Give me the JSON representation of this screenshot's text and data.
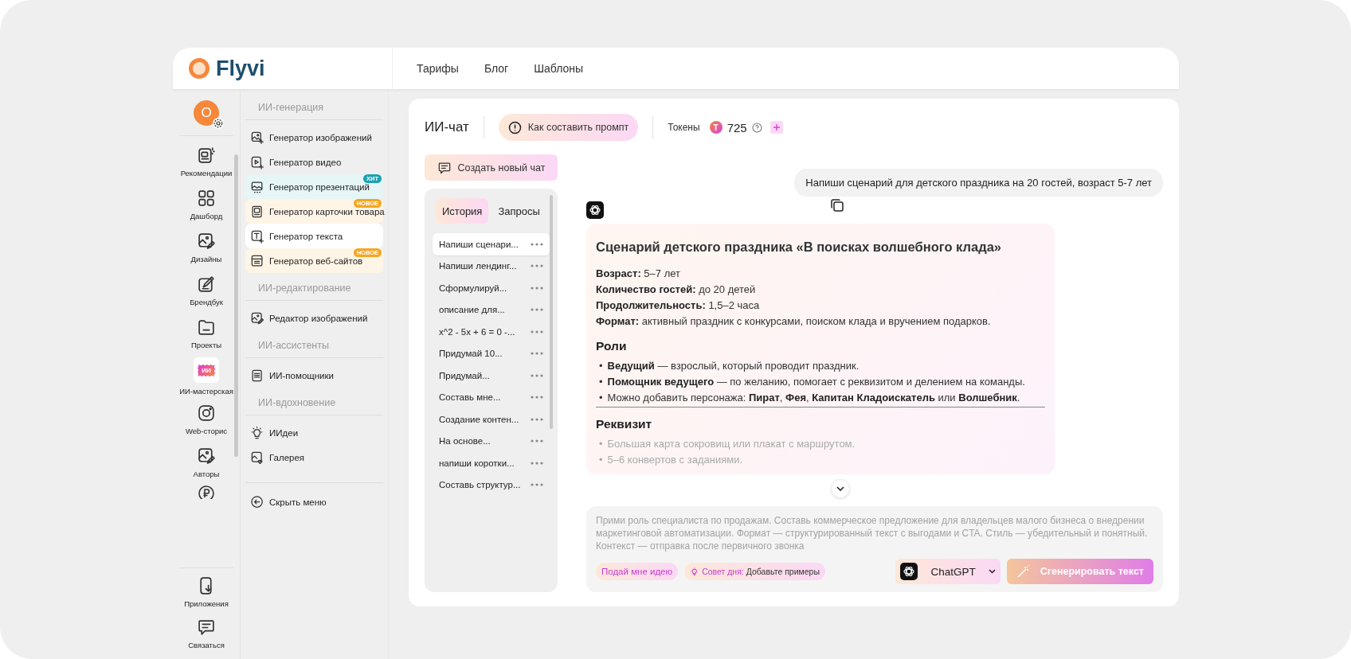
{
  "logo": {
    "name": "Flyvi"
  },
  "nav": [
    "Тарифы",
    "Блог",
    "Шаблоны"
  ],
  "profile": {
    "initial": "О"
  },
  "rail": [
    {
      "label": "Рекомендации",
      "kind": "recommend"
    },
    {
      "label": "Дашборд",
      "kind": "grid"
    },
    {
      "label": "Дизайны",
      "kind": "design"
    },
    {
      "label": "Брендбук",
      "kind": "pen"
    },
    {
      "label": "Проекты",
      "kind": "folder"
    },
    {
      "label": "ИИ-мастерская",
      "kind": "ai",
      "badge": "ИИ"
    },
    {
      "label": "Web-сторис",
      "kind": "camera"
    },
    {
      "label": "Авторы",
      "kind": "design"
    }
  ],
  "rail_bottom": [
    {
      "label": "Приложения",
      "kind": "phone"
    },
    {
      "label": "Связаться",
      "kind": "chat"
    }
  ],
  "menu": [
    {
      "heading": "ИИ-генерация",
      "items": [
        {
          "label": "Генератор изображений",
          "kind": "image",
          "selected": false
        },
        {
          "label": "Генератор видео",
          "kind": "video",
          "selected": false
        },
        {
          "label": "Генератор презентаций",
          "kind": "slides",
          "selected": false,
          "badge": {
            "text": "ХИТ",
            "color": "#1aa3b0"
          }
        },
        {
          "label": "Генератор карточки товара",
          "kind": "card",
          "selected": false,
          "badge": {
            "text": "НОВОЕ",
            "color": "#f5a623"
          }
        },
        {
          "label": "Генератор текста",
          "kind": "text",
          "selected": true
        },
        {
          "label": "Генератор веб-сайтов",
          "kind": "web",
          "selected": false,
          "badge": {
            "text": "НОВОЕ",
            "color": "#f5a623"
          }
        }
      ]
    },
    {
      "heading": "ИИ-редактирование",
      "items": [
        {
          "label": "Редактор изображений",
          "kind": "design",
          "selected": false
        }
      ]
    },
    {
      "heading": "ИИ-ассистенты",
      "items": [
        {
          "label": "ИИ-помощники",
          "kind": "doc",
          "selected": false
        }
      ]
    },
    {
      "heading": "ИИ-вдохновение",
      "items": [
        {
          "label": "ИИдеи",
          "kind": "bulb",
          "selected": false
        },
        {
          "label": "Галерея",
          "kind": "gallery",
          "selected": false
        }
      ]
    }
  ],
  "hide_menu": "Скрыть меню",
  "chat": {
    "title": "ИИ-чат",
    "prompt_help": "Как составить промпт",
    "tokens_label": "Токены",
    "token_symbol": "T",
    "tokens": "725",
    "new_chat": "Создать новый чат",
    "tabs": [
      {
        "label": "История",
        "selected": true
      },
      {
        "label": "Запросы",
        "selected": false
      }
    ],
    "history": [
      {
        "title": "Напиши сценари...",
        "selected": true
      },
      {
        "title": "Напиши лендинг...",
        "selected": false
      },
      {
        "title": "Сформулируй...",
        "selected": false
      },
      {
        "title": "описание для...",
        "selected": false
      },
      {
        "title": "x^2 - 5x + 6 = 0 -...",
        "selected": false
      },
      {
        "title": "Придумай 10...",
        "selected": false
      },
      {
        "title": "Придумай...",
        "selected": false
      },
      {
        "title": "Составь мне...",
        "selected": false
      },
      {
        "title": "Создание контен...",
        "selected": false
      },
      {
        "title": "На основе...",
        "selected": false
      },
      {
        "title": "напиши коротки...",
        "selected": false
      },
      {
        "title": "Составь структур...",
        "selected": false
      }
    ],
    "user_message": "Напиши сценарий для детского праздника на 20 гостей, возраст 5-7 лет",
    "response": {
      "title": "Сценарий детского праздника «В поисках волшебного клада»",
      "facts": [
        {
          "label": "Возраст:",
          "value": "5–7 лет"
        },
        {
          "label": "Количество гостей:",
          "value": "до 20 детей"
        },
        {
          "label": "Продолжительность:",
          "value": "1,5–2 часа"
        },
        {
          "label": "Формат:",
          "value": "активный праздник с конкурсами, поиском клада и вручением подарков."
        }
      ],
      "sections": [
        {
          "heading": "Роли",
          "faded": false,
          "marker": "•",
          "bullets": [
            "**Ведущий** — взрослый, который проводит праздник.",
            "**Помощник ведущего** — по желанию, помогает с реквизитом и делением на команды.",
            "Можно добавить персонажа: **Пират**, **Фея**, **Капитан Кладоискатель** или **Волшебник**."
          ]
        },
        {
          "heading": "Реквизит",
          "faded": true,
          "marker": "•",
          "bullets": [
            "Большая карта сокровищ или плакат с маршрутом.",
            "5–6 конвертов с заданиями."
          ]
        }
      ]
    },
    "input": {
      "placeholder": "Прими роль специалиста по продажам. Составь коммерческое предложение для владельцев малого бизнеса о внедрении маркетинговой автоматизации. Формат — структурированный текст с выгодами и CTA. Стиль — убедительный и понятный. Контекст — отправка после первичного звонка"
    },
    "idea_button": "Подай мне идею",
    "tip": {
      "label": "Совет дня:",
      "text": "Добавьте примеры"
    },
    "model": "ChatGPT",
    "generate": "Сгенерировать текст"
  }
}
